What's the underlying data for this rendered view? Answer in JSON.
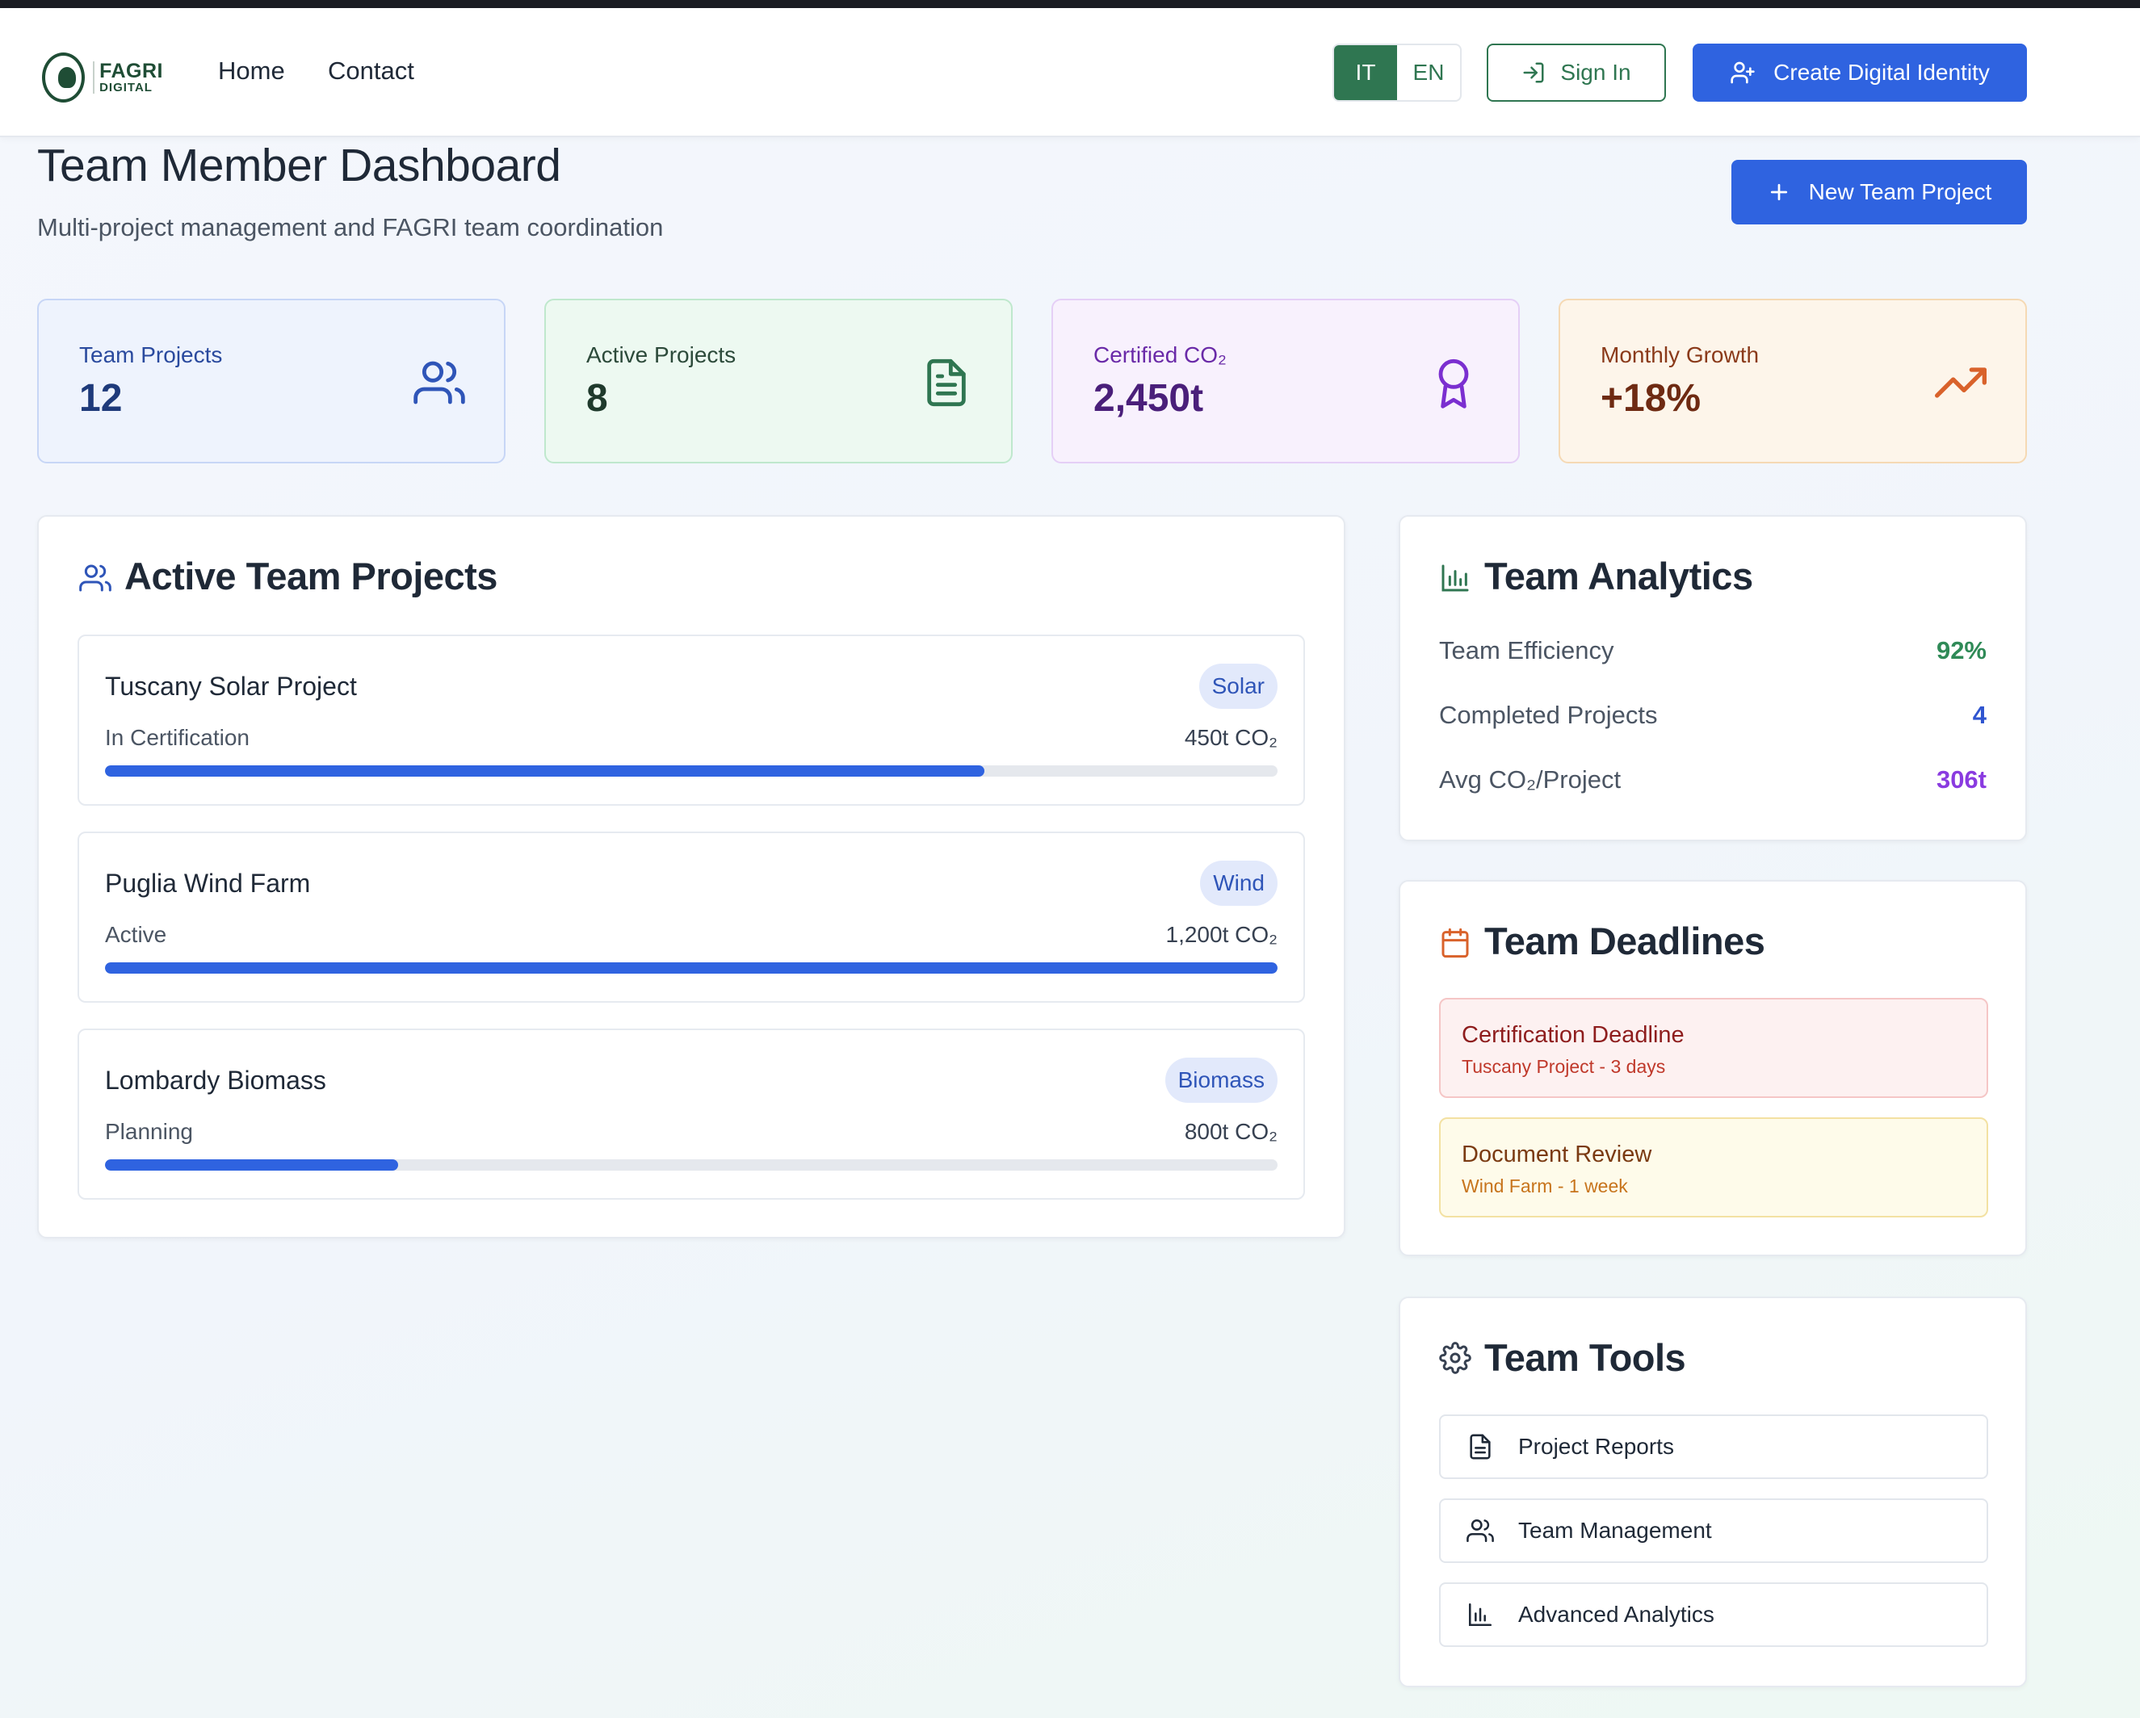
{
  "header": {
    "logo_line1": "FAGRI",
    "logo_line2": "DIGITAL",
    "nav": [
      "Home",
      "Contact"
    ],
    "lang_options": [
      "IT",
      "EN"
    ],
    "lang_active": "IT",
    "signin_label": "Sign In",
    "create_label": "Create Digital Identity"
  },
  "page": {
    "title": "Team Member Dashboard",
    "subtitle": "Multi-project management and FAGRI team coordination",
    "new_project_label": "New Team Project"
  },
  "stats": [
    {
      "label": "Team Projects",
      "value": "12",
      "icon": "users-icon",
      "color": "#2f55b8"
    },
    {
      "label": "Active Projects",
      "value": "8",
      "icon": "document-icon",
      "color": "#2f7651"
    },
    {
      "label": "Certified CO₂",
      "value": "2,450t",
      "icon": "award-icon",
      "color": "#7b2fd0"
    },
    {
      "label": "Monthly Growth",
      "value": "+18%",
      "icon": "trending-up-icon",
      "color": "#d9622b"
    }
  ],
  "projects": {
    "title": "Active Team Projects",
    "items": [
      {
        "name": "Tuscany Solar Project",
        "type": "Solar",
        "status": "In Certification",
        "co2": "450t CO₂",
        "progress": 0.75
      },
      {
        "name": "Puglia Wind Farm",
        "type": "Wind",
        "status": "Active",
        "co2": "1,200t CO₂",
        "progress": 1.0
      },
      {
        "name": "Lombardy Biomass",
        "type": "Biomass",
        "status": "Planning",
        "co2": "800t CO₂",
        "progress": 0.25
      }
    ]
  },
  "analytics": {
    "title": "Team Analytics",
    "rows": [
      {
        "label": "Team Efficiency",
        "value": "92%",
        "color": "#2f8a57"
      },
      {
        "label": "Completed Projects",
        "value": "4",
        "color": "#2f55d0"
      },
      {
        "label": "Avg CO₂/Project",
        "value": "306t",
        "color": "#8a3be0"
      }
    ]
  },
  "deadlines": {
    "title": "Team Deadlines",
    "items": [
      {
        "title": "Certification Deadline",
        "sub": "Tuscany Project - 3 days",
        "tone": "red"
      },
      {
        "title": "Document Review",
        "sub": "Wind Farm - 1 week",
        "tone": "yellow"
      }
    ]
  },
  "tools": {
    "title": "Team Tools",
    "items": [
      {
        "label": "Project Reports",
        "icon": "document-icon"
      },
      {
        "label": "Team Management",
        "icon": "users-icon"
      },
      {
        "label": "Advanced Analytics",
        "icon": "bar-chart-icon"
      }
    ]
  }
}
